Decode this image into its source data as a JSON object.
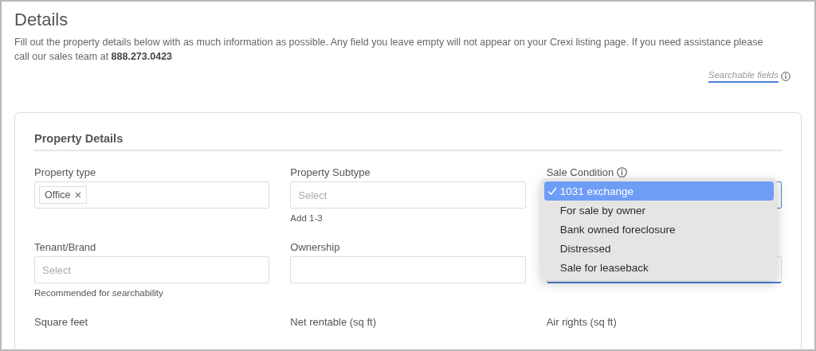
{
  "title": "Details",
  "description": "Fill out the property details below with as much information as possible. Any field you leave empty will not appear on your Crexi listing page. If you need assistance please call our sales team at **888.273.0423**",
  "searchable_link": "Searchable fields",
  "card": {
    "title": "Property Details",
    "fields": [
      {
        "kind": "tags",
        "label": "Property type",
        "tags": [
          "Office"
        ]
      },
      {
        "kind": "select",
        "label": "Property Subtype",
        "placeholder": "Select",
        "helper": "Add 1-3"
      },
      {
        "kind": "dropdown",
        "label": "Sale Condition",
        "info": true,
        "options": [
          {
            "label": "1031 exchange",
            "selected": true
          },
          {
            "label": "For sale by owner",
            "selected": false
          },
          {
            "label": "Bank owned foreclosure",
            "selected": false
          },
          {
            "label": "Distressed",
            "selected": false
          },
          {
            "label": "Sale for leaseback",
            "selected": false
          }
        ]
      },
      {
        "kind": "select",
        "label": "Tenant/Brand",
        "placeholder": "Select",
        "helper": "Recommended for searchability"
      },
      {
        "kind": "input",
        "label": "Ownership"
      },
      {
        "kind": "covered"
      },
      {
        "kind": "cut",
        "label": "Square feet"
      },
      {
        "kind": "cut",
        "label": "Net rentable (sq ft)"
      },
      {
        "kind": "cut",
        "label": "Air rights (sq ft)"
      }
    ]
  }
}
